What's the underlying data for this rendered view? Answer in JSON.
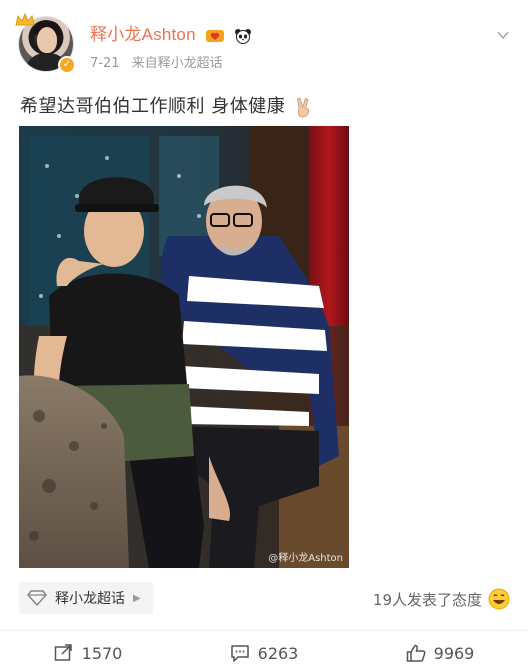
{
  "header": {
    "username": "释小龙Ashton",
    "date": "7-21",
    "source_prefix": "来自",
    "source": "释小龙超话"
  },
  "post": {
    "text": "希望达哥伯伯工作顺利 身体健康",
    "image_watermark": "@释小龙Ashton"
  },
  "topic": {
    "label": "释小龙超话"
  },
  "attitude": {
    "text": "19人发表了态度"
  },
  "actions": {
    "repost_count": "1570",
    "comment_count": "6263",
    "like_count": "9969"
  },
  "colors": {
    "username": "#eb7350",
    "meta": "#999999",
    "verified_badge": "#f5a623"
  },
  "icons": {
    "crown": "crown-icon",
    "verified": "verified-badge-icon",
    "vip": "vip-heart-icon",
    "panda": "panda-emoji-icon",
    "victory": "victory-hand-emoji-icon",
    "more": "chevron-down-icon",
    "topic": "diamond-topic-icon",
    "smile": "smile-emoji-icon",
    "repost": "repost-icon",
    "comment": "comment-icon",
    "like": "like-icon"
  }
}
